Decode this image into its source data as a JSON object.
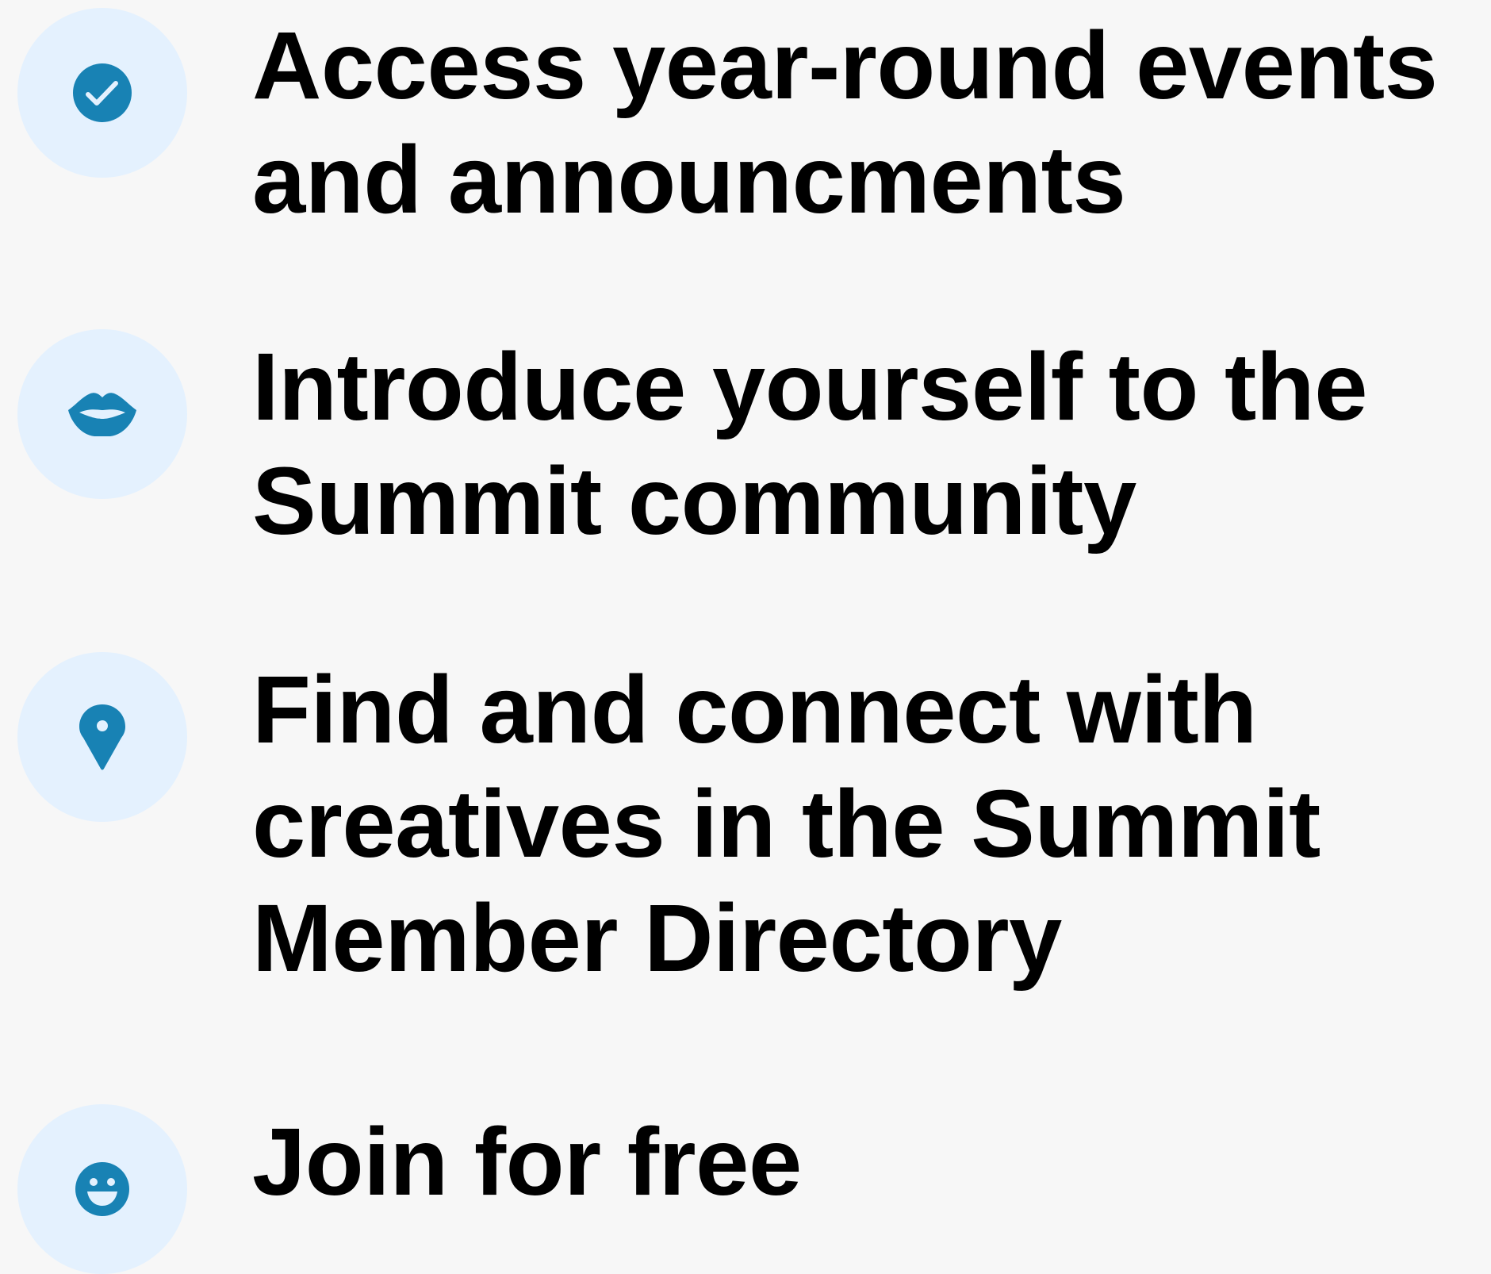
{
  "colors": {
    "background": "#f7f7f7",
    "icon_circle": "#e4f1fe",
    "icon_fill": "#1882b4",
    "text": "#000000"
  },
  "features": [
    {
      "icon": "check-circle-icon",
      "lines": [
        "Access year-round events",
        "and announcments"
      ]
    },
    {
      "icon": "lips-icon",
      "lines": [
        "Introduce yourself to the",
        "Summit community"
      ]
    },
    {
      "icon": "map-pin-icon",
      "lines": [
        "Find and connect with",
        "creatives in the Summit",
        "Member Directory"
      ]
    },
    {
      "icon": "smiley-face-icon",
      "lines": [
        "Join for free"
      ]
    }
  ]
}
